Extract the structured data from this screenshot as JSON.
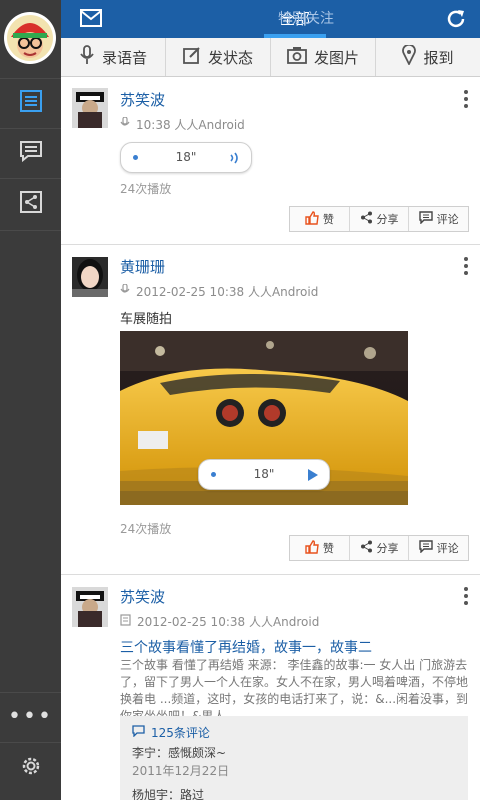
{
  "sidebar": {
    "avatar": "avatar",
    "items": [
      {
        "name": "feed-icon",
        "active": true
      },
      {
        "name": "messages-icon",
        "active": false
      },
      {
        "name": "share-icon",
        "active": false
      }
    ],
    "more": "more-icon",
    "settings": "gear-icon"
  },
  "topbar": {
    "tabs": [
      {
        "label": "全部",
        "active": true
      },
      {
        "label": "特别关注",
        "active": false
      }
    ],
    "mail_icon": "mail-icon",
    "refresh_icon": "refresh-icon"
  },
  "actions": [
    {
      "label": "录语音",
      "icon": "mic-icon"
    },
    {
      "label": "发状态",
      "icon": "edit-icon"
    },
    {
      "label": "发图片",
      "icon": "camera-icon"
    },
    {
      "label": "报到",
      "icon": "location-icon"
    }
  ],
  "posts": [
    {
      "name": "苏笑波",
      "meta": "10:38 人人Android",
      "voice_duration": "18\"",
      "plays": "24次播放",
      "buttons": [
        "赞",
        "分享",
        "评论"
      ]
    },
    {
      "name": "黄珊珊",
      "meta": "2012-02-25 10:38 人人Android",
      "text": "车展随拍",
      "voice_duration": "18\"",
      "plays": "24次播放",
      "buttons": [
        "赞",
        "分享",
        "评论"
      ]
    },
    {
      "name": "苏笑波",
      "meta": "2012-02-25 10:38 人人Android",
      "article_title": "三个故事看懂了再结婚，故事一，故事二",
      "article_body": "三个故事 看懂了再结婚 来源： 李佳鑫的故事:一 女人出 门旅游去了，留下了男人一个人在家。女人不在家，男人喝着啤酒，不停地换着电 ...频道，这时，女孩的电话打来了，说：&...闲着没事，到你家坐坐吧！&男人",
      "comments": {
        "count_label": "125条评论",
        "lines": [
          {
            "text": "李宁：感慨颇深~"
          },
          {
            "text": "2011年12月22日"
          },
          {
            "text": "杨旭宇：路过"
          }
        ]
      }
    }
  ],
  "colors": {
    "accent": "#1c5fa6",
    "sidebar": "#3b3b3b",
    "like_orange": "#e8531e",
    "link_blue": "#3a7fd0"
  }
}
